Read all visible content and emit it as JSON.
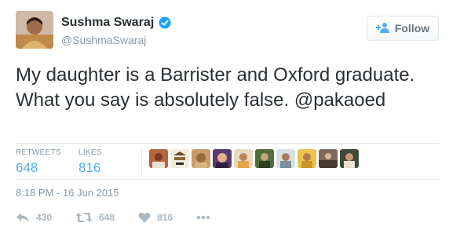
{
  "tweet": {
    "display_name": "Sushma Swaraj",
    "handle": "@SushmaSwaraj",
    "follow_label": "Follow",
    "text": "My daughter is a Barrister and Oxford graduate. What you say is absolutely false. @pakaoed",
    "stats": {
      "retweets_label": "RETWEETS",
      "retweets_value": "648",
      "likes_label": "LIKES",
      "likes_value": "816"
    },
    "timestamp": "8:18 PM - 16 Jun 2015",
    "actions": {
      "reply_count": "430",
      "retweet_count": "648",
      "like_count": "816"
    }
  },
  "icons": [
    "verified-icon",
    "follow-user-icon",
    "reply-icon",
    "retweet-icon",
    "heart-icon",
    "more-icon"
  ],
  "colors": {
    "accent": "#55acee",
    "verified": "#1da1f2",
    "text": "#292f33",
    "muted": "#8899a6",
    "divider": "#e1e8ed"
  }
}
